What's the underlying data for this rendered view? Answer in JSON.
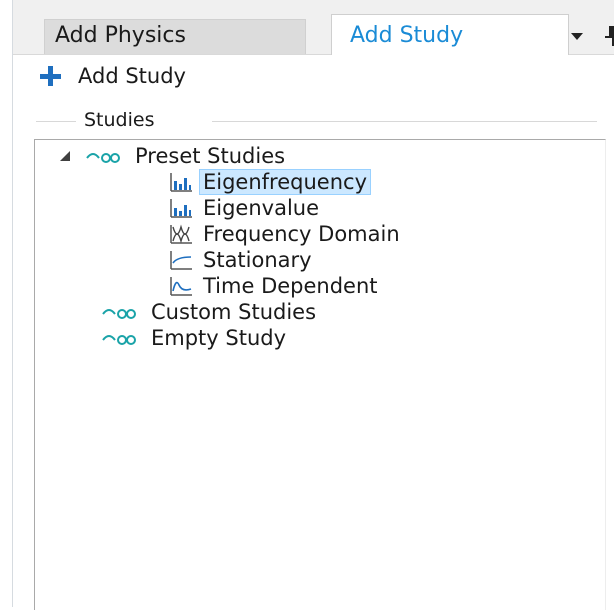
{
  "tabs": {
    "inactive_label": "Add Physics",
    "active_label": "Add Study"
  },
  "toolbar": {
    "add_study_label": "Add Study"
  },
  "studies_group": {
    "title": "Studies"
  },
  "tree": {
    "preset_studies": {
      "label": "Preset Studies",
      "expanded": true,
      "children": [
        {
          "label": "Eigenfrequency",
          "icon": "eigenfrequency-icon",
          "selected": true
        },
        {
          "label": "Eigenvalue",
          "icon": "eigenvalue-icon",
          "selected": false
        },
        {
          "label": "Frequency Domain",
          "icon": "frequency-domain-icon",
          "selected": false
        },
        {
          "label": "Stationary",
          "icon": "stationary-icon",
          "selected": false
        },
        {
          "label": "Time Dependent",
          "icon": "time-dependent-icon",
          "selected": false
        }
      ]
    },
    "custom_studies": {
      "label": "Custom Studies"
    },
    "empty_study": {
      "label": "Empty Study"
    }
  },
  "colors": {
    "accent": "#1a8bd6",
    "study_icon": "#1aa3a8",
    "selection_fill": "#cce8ff",
    "selection_border": "#99d1ff"
  }
}
